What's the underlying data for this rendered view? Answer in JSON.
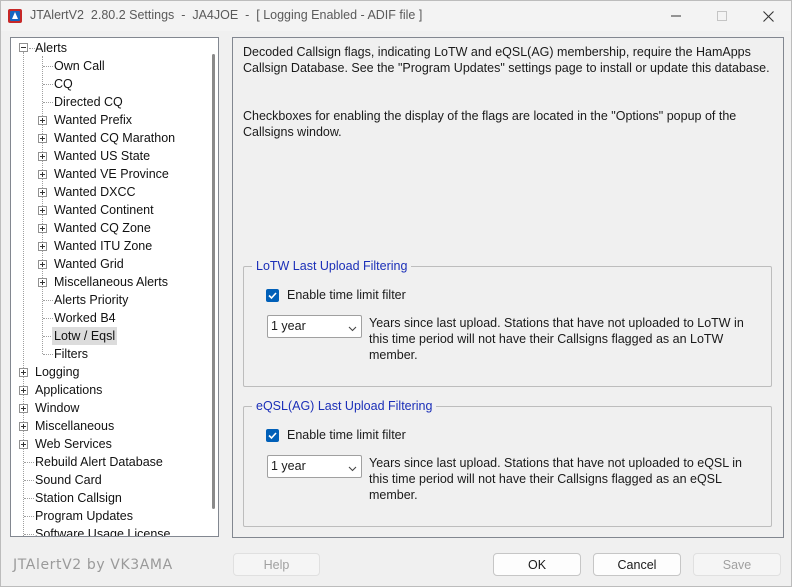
{
  "window": {
    "title": "JTAlertV2  2.80.2 Settings  -  JA4JOE  -  [ Logging Enabled - ADIF file ]"
  },
  "tree": {
    "alerts": {
      "label": "Alerts",
      "children": [
        {
          "label": "Own Call",
          "expandable": false
        },
        {
          "label": "CQ",
          "expandable": false
        },
        {
          "label": "Directed CQ",
          "expandable": false
        },
        {
          "label": "Wanted Prefix",
          "expandable": true
        },
        {
          "label": "Wanted CQ Marathon",
          "expandable": true
        },
        {
          "label": "Wanted US State",
          "expandable": true
        },
        {
          "label": "Wanted VE Province",
          "expandable": true
        },
        {
          "label": "Wanted DXCC",
          "expandable": true
        },
        {
          "label": "Wanted Continent",
          "expandable": true
        },
        {
          "label": "Wanted CQ Zone",
          "expandable": true
        },
        {
          "label": "Wanted ITU Zone",
          "expandable": true
        },
        {
          "label": "Wanted Grid",
          "expandable": true
        },
        {
          "label": "Miscellaneous Alerts",
          "expandable": true
        },
        {
          "label": "Alerts Priority",
          "expandable": false
        },
        {
          "label": "Worked B4",
          "expandable": false
        },
        {
          "label": "Lotw / Eqsl",
          "expandable": false,
          "selected": true
        },
        {
          "label": "Filters",
          "expandable": false
        }
      ]
    },
    "roots": [
      {
        "label": "Logging",
        "expandable": true
      },
      {
        "label": "Applications",
        "expandable": true
      },
      {
        "label": "Window",
        "expandable": true
      },
      {
        "label": "Miscellaneous",
        "expandable": true
      },
      {
        "label": "Web Services",
        "expandable": true
      },
      {
        "label": "Rebuild Alert Database",
        "expandable": false
      },
      {
        "label": "Sound Card",
        "expandable": false
      },
      {
        "label": "Station Callsign",
        "expandable": false
      },
      {
        "label": "Program Updates",
        "expandable": false
      },
      {
        "label": "Software Usage License",
        "expandable": false
      }
    ]
  },
  "content": {
    "description1": "Decoded Callsign flags, indicating LoTW and eQSL(AG) membership, require the HamApps Callsign Database. See the \"Program Updates\" settings page to install or update this database.",
    "description2": "Checkboxes for enabling the display of the flags are located in the \"Options\" popup of the Callsigns window.",
    "lotw": {
      "title": "LoTW Last Upload Filtering",
      "checkbox_label": "Enable time limit filter",
      "checked": true,
      "select_value": "1 year",
      "description": "Years since last upload. Stations that have not uploaded to LoTW in this time period will not have their Callsigns flagged as an LoTW member."
    },
    "eqsl": {
      "title": "eQSL(AG) Last Upload Filtering",
      "checkbox_label": "Enable time limit filter",
      "checked": true,
      "select_value": "1 year",
      "description": "Years since last upload. Stations that have not uploaded to eQSL in this time period will not have their Callsigns flagged as an eQSL member."
    }
  },
  "footer": {
    "brand": "JTAlertV2 by VK3AMA",
    "help_label": "Help",
    "ok_label": "OK",
    "cancel_label": "Cancel",
    "save_label": "Save"
  },
  "colors": {
    "accent": "#005fb8",
    "group_title": "#1b2fb8",
    "window_bg": "#f0f0f0"
  }
}
